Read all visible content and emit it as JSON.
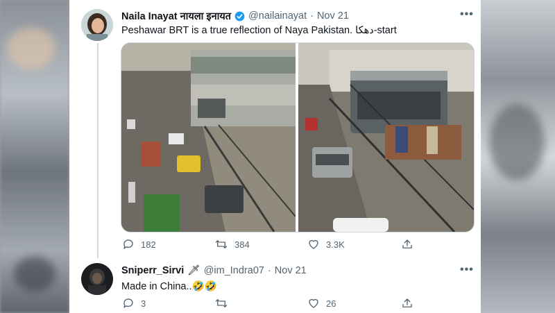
{
  "tweet": {
    "author_name": "Naila Inayat नायला इनायत",
    "handle": "@nailainayat",
    "separator": "·",
    "date": "Nov 21",
    "text": "Peshawar BRT is a true reflection of Naya Pakistan. دھکا-start",
    "actions": {
      "replies": "182",
      "retweets": "384",
      "likes": "3.3K"
    }
  },
  "reply": {
    "author_name": "Sniperr_Sirvi",
    "name_emoji": "🗡",
    "handle": "@im_Indra07",
    "separator": "·",
    "date": "Nov 21",
    "text": "Made in China..🤣🤣",
    "actions": {
      "replies": "3",
      "retweets": "",
      "likes": "26"
    }
  },
  "colors": {
    "verified": "#1d9bf0",
    "muted": "#536471",
    "text": "#0f1419"
  },
  "icons": [
    "verified-badge-icon",
    "more-icon",
    "reply-icon",
    "retweet-icon",
    "like-icon",
    "share-icon"
  ]
}
